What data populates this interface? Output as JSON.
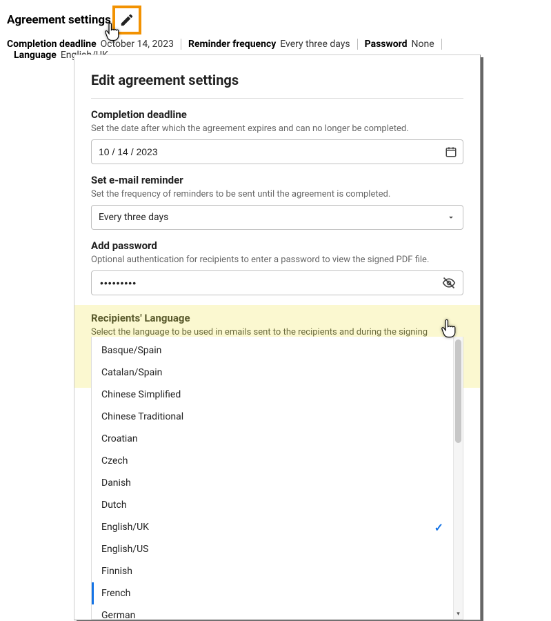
{
  "header": {
    "title": "Agreement settings",
    "summary": {
      "completion_deadline_label": "Completion deadline",
      "completion_deadline_value": "October 14, 2023",
      "reminder_label": "Reminder frequency",
      "reminder_value": "Every three days",
      "password_label": "Password",
      "password_value": "None",
      "language_label": "Language",
      "language_value": "English/UK"
    }
  },
  "modal": {
    "title": "Edit agreement settings",
    "deadline": {
      "title": "Completion deadline",
      "desc": "Set the date after which the agreement expires and can no longer be completed.",
      "value": "10 / 14 / 2023"
    },
    "reminder": {
      "title": "Set e-mail reminder",
      "desc": "Set the frequency of reminders to be sent until the agreement is completed.",
      "value": "Every three days"
    },
    "password": {
      "title": "Add password",
      "desc": "Optional authentication for recipients to enter a password to view the signed PDF file.",
      "masked": "•••••••••"
    },
    "language": {
      "title": "Recipients' Language",
      "desc": "Select the language to be used in emails sent to the recipients and during the signing experience.",
      "selected": "English/UK",
      "options": [
        "Basque/Spain",
        "Catalan/Spain",
        "Chinese Simplified",
        "Chinese Traditional",
        "Croatian",
        "Czech",
        "Danish",
        "Dutch",
        "English/UK",
        "English/US",
        "Finnish",
        "French",
        "German"
      ],
      "hovered_index": 11
    }
  }
}
